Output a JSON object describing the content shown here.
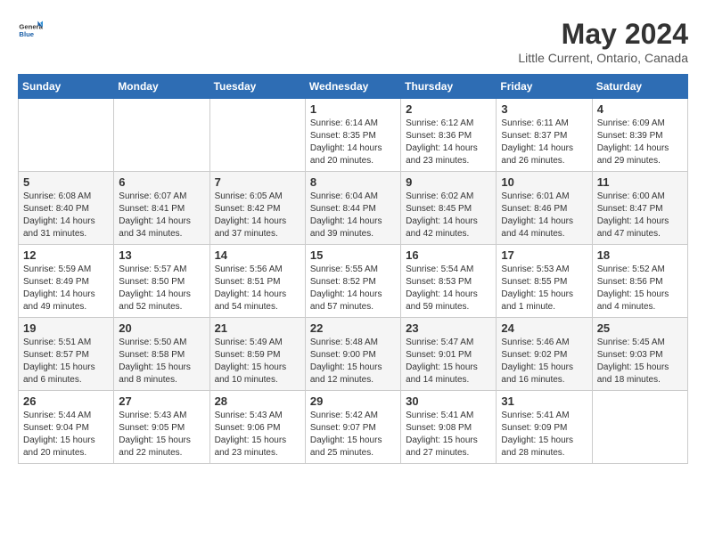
{
  "header": {
    "logo_general": "General",
    "logo_blue": "Blue",
    "month_title": "May 2024",
    "location": "Little Current, Ontario, Canada"
  },
  "weekdays": [
    "Sunday",
    "Monday",
    "Tuesday",
    "Wednesday",
    "Thursday",
    "Friday",
    "Saturday"
  ],
  "weeks": [
    [
      {
        "day": "",
        "info": ""
      },
      {
        "day": "",
        "info": ""
      },
      {
        "day": "",
        "info": ""
      },
      {
        "day": "1",
        "info": "Sunrise: 6:14 AM\nSunset: 8:35 PM\nDaylight: 14 hours\nand 20 minutes."
      },
      {
        "day": "2",
        "info": "Sunrise: 6:12 AM\nSunset: 8:36 PM\nDaylight: 14 hours\nand 23 minutes."
      },
      {
        "day": "3",
        "info": "Sunrise: 6:11 AM\nSunset: 8:37 PM\nDaylight: 14 hours\nand 26 minutes."
      },
      {
        "day": "4",
        "info": "Sunrise: 6:09 AM\nSunset: 8:39 PM\nDaylight: 14 hours\nand 29 minutes."
      }
    ],
    [
      {
        "day": "5",
        "info": "Sunrise: 6:08 AM\nSunset: 8:40 PM\nDaylight: 14 hours\nand 31 minutes."
      },
      {
        "day": "6",
        "info": "Sunrise: 6:07 AM\nSunset: 8:41 PM\nDaylight: 14 hours\nand 34 minutes."
      },
      {
        "day": "7",
        "info": "Sunrise: 6:05 AM\nSunset: 8:42 PM\nDaylight: 14 hours\nand 37 minutes."
      },
      {
        "day": "8",
        "info": "Sunrise: 6:04 AM\nSunset: 8:44 PM\nDaylight: 14 hours\nand 39 minutes."
      },
      {
        "day": "9",
        "info": "Sunrise: 6:02 AM\nSunset: 8:45 PM\nDaylight: 14 hours\nand 42 minutes."
      },
      {
        "day": "10",
        "info": "Sunrise: 6:01 AM\nSunset: 8:46 PM\nDaylight: 14 hours\nand 44 minutes."
      },
      {
        "day": "11",
        "info": "Sunrise: 6:00 AM\nSunset: 8:47 PM\nDaylight: 14 hours\nand 47 minutes."
      }
    ],
    [
      {
        "day": "12",
        "info": "Sunrise: 5:59 AM\nSunset: 8:49 PM\nDaylight: 14 hours\nand 49 minutes."
      },
      {
        "day": "13",
        "info": "Sunrise: 5:57 AM\nSunset: 8:50 PM\nDaylight: 14 hours\nand 52 minutes."
      },
      {
        "day": "14",
        "info": "Sunrise: 5:56 AM\nSunset: 8:51 PM\nDaylight: 14 hours\nand 54 minutes."
      },
      {
        "day": "15",
        "info": "Sunrise: 5:55 AM\nSunset: 8:52 PM\nDaylight: 14 hours\nand 57 minutes."
      },
      {
        "day": "16",
        "info": "Sunrise: 5:54 AM\nSunset: 8:53 PM\nDaylight: 14 hours\nand 59 minutes."
      },
      {
        "day": "17",
        "info": "Sunrise: 5:53 AM\nSunset: 8:55 PM\nDaylight: 15 hours\nand 1 minute."
      },
      {
        "day": "18",
        "info": "Sunrise: 5:52 AM\nSunset: 8:56 PM\nDaylight: 15 hours\nand 4 minutes."
      }
    ],
    [
      {
        "day": "19",
        "info": "Sunrise: 5:51 AM\nSunset: 8:57 PM\nDaylight: 15 hours\nand 6 minutes."
      },
      {
        "day": "20",
        "info": "Sunrise: 5:50 AM\nSunset: 8:58 PM\nDaylight: 15 hours\nand 8 minutes."
      },
      {
        "day": "21",
        "info": "Sunrise: 5:49 AM\nSunset: 8:59 PM\nDaylight: 15 hours\nand 10 minutes."
      },
      {
        "day": "22",
        "info": "Sunrise: 5:48 AM\nSunset: 9:00 PM\nDaylight: 15 hours\nand 12 minutes."
      },
      {
        "day": "23",
        "info": "Sunrise: 5:47 AM\nSunset: 9:01 PM\nDaylight: 15 hours\nand 14 minutes."
      },
      {
        "day": "24",
        "info": "Sunrise: 5:46 AM\nSunset: 9:02 PM\nDaylight: 15 hours\nand 16 minutes."
      },
      {
        "day": "25",
        "info": "Sunrise: 5:45 AM\nSunset: 9:03 PM\nDaylight: 15 hours\nand 18 minutes."
      }
    ],
    [
      {
        "day": "26",
        "info": "Sunrise: 5:44 AM\nSunset: 9:04 PM\nDaylight: 15 hours\nand 20 minutes."
      },
      {
        "day": "27",
        "info": "Sunrise: 5:43 AM\nSunset: 9:05 PM\nDaylight: 15 hours\nand 22 minutes."
      },
      {
        "day": "28",
        "info": "Sunrise: 5:43 AM\nSunset: 9:06 PM\nDaylight: 15 hours\nand 23 minutes."
      },
      {
        "day": "29",
        "info": "Sunrise: 5:42 AM\nSunset: 9:07 PM\nDaylight: 15 hours\nand 25 minutes."
      },
      {
        "day": "30",
        "info": "Sunrise: 5:41 AM\nSunset: 9:08 PM\nDaylight: 15 hours\nand 27 minutes."
      },
      {
        "day": "31",
        "info": "Sunrise: 5:41 AM\nSunset: 9:09 PM\nDaylight: 15 hours\nand 28 minutes."
      },
      {
        "day": "",
        "info": ""
      }
    ]
  ]
}
